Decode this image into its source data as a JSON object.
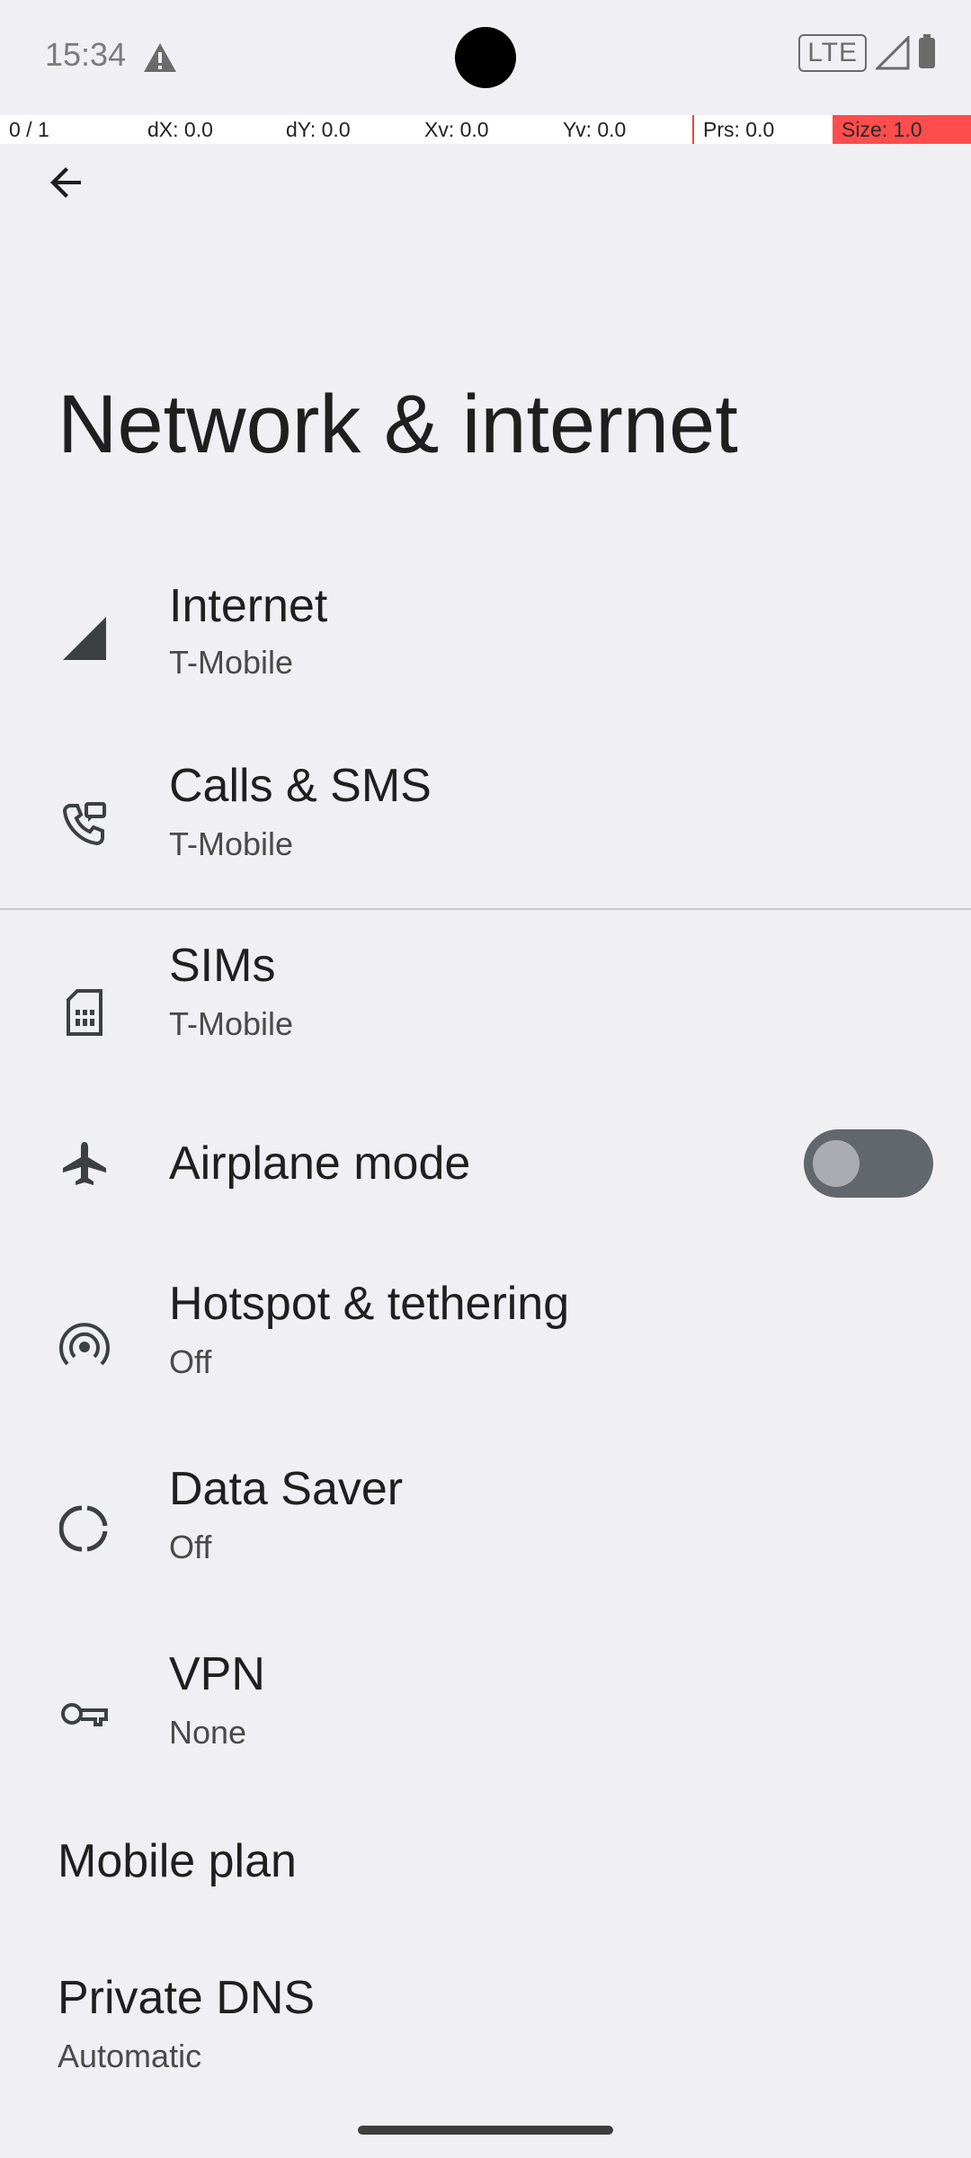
{
  "status_bar": {
    "time": "15:34",
    "network_type": "LTE",
    "alert_icon": "warning-icon",
    "signal_icon": "signal-icon",
    "battery_icon": "battery-icon"
  },
  "debug_overlay": {
    "pointer": "0 / 1",
    "dx": "dX: 0.0",
    "dy": "dY: 0.0",
    "xv": "Xv: 0.0",
    "yv": "Yv: 0.0",
    "prs": "Prs: 0.0",
    "size": "Size: 1.0"
  },
  "header": {
    "back_icon": "arrow-back-icon",
    "title": "Network & internet"
  },
  "items": {
    "internet": {
      "title": "Internet",
      "summary": "T-Mobile",
      "icon": "cell-signal-icon"
    },
    "calls_sms": {
      "title": "Calls & SMS",
      "summary": "T-Mobile",
      "icon": "phone-message-icon"
    },
    "sims": {
      "title": "SIMs",
      "summary": "T-Mobile",
      "icon": "sim-card-icon"
    },
    "airplane": {
      "title": "Airplane mode",
      "icon": "airplane-icon",
      "toggle_on": false
    },
    "hotspot": {
      "title": "Hotspot & tethering",
      "summary": "Off",
      "icon": "hotspot-icon"
    },
    "data_saver": {
      "title": "Data Saver",
      "summary": "Off",
      "icon": "data-saver-icon"
    },
    "vpn": {
      "title": "VPN",
      "summary": "None",
      "icon": "key-icon"
    },
    "mobile_plan": {
      "title": "Mobile plan"
    },
    "private_dns": {
      "title": "Private DNS",
      "summary": "Automatic"
    }
  },
  "colors": {
    "background": "#f0eff4",
    "text_primary": "#1f1f1f",
    "text_secondary": "#4a4a4a",
    "icon": "#3c4043",
    "toggle_track_off": "#61676c",
    "toggle_knob_off": "#a9adb1"
  }
}
